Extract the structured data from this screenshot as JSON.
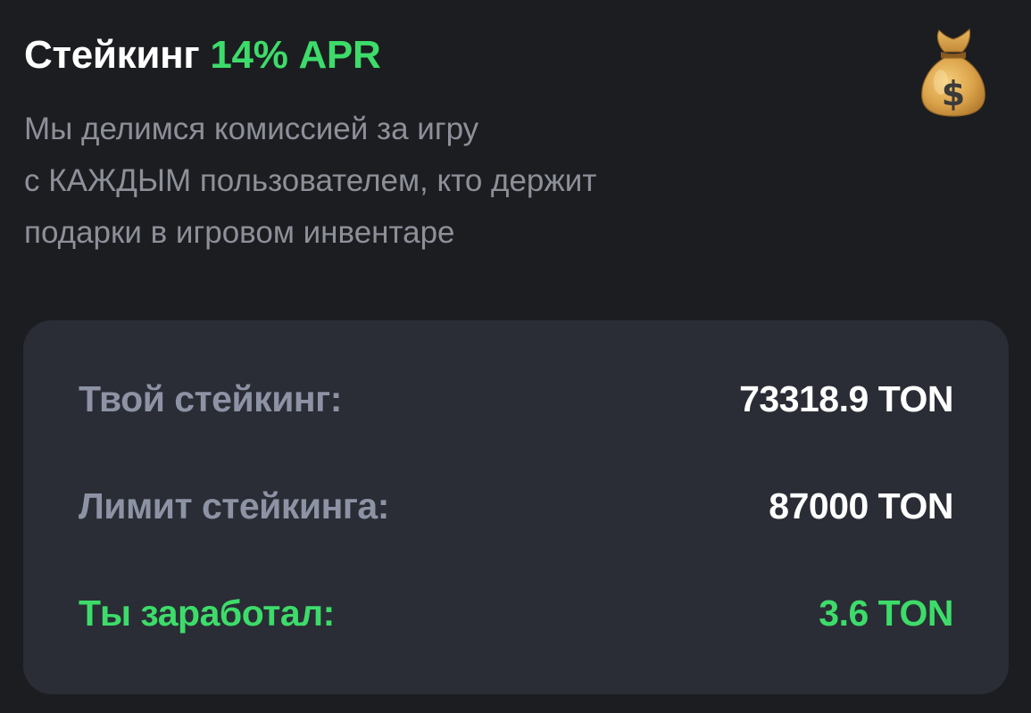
{
  "header": {
    "title": "Стейкинг",
    "apr": "14% APR",
    "description_lines": [
      "Мы делимся комиссией за игру",
      "с КАЖДЫМ пользователем, кто держит",
      "подарки в игровом инвентаре"
    ],
    "icon": "money-bag-icon"
  },
  "stats": {
    "staking_label": "Твой стейкинг:",
    "staking_value": "73318.9 TON",
    "limit_label": "Лимит стейкинга:",
    "limit_value": "87000 TON",
    "earned_label": "Ты заработал:",
    "earned_value": "3.6 TON"
  },
  "colors": {
    "background": "#1c1d21",
    "card": "#2a2d35",
    "accent_green": "#3ddc6a",
    "muted_text": "#8d9099"
  }
}
